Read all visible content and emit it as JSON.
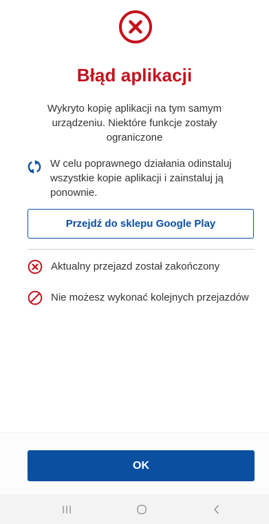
{
  "dialog": {
    "title": "Błąd aplikacji",
    "description": "Wykryto kopię aplikacji na tym samym urządzeniu. Niektóre funkcje zostały ograniczone",
    "reinstall_info": "W celu poprawnego działania odinstaluj wszystkie kopie aplikacji i zainstaluj ją ponownie.",
    "store_button_label": "Przejdź do sklepu Google Play",
    "status_items": [
      {
        "icon": "x-circle-icon",
        "text": "Aktualny przejazd został zakończony"
      },
      {
        "icon": "prohibited-icon",
        "text": "Nie możesz wykonać kolejnych przejazdów"
      }
    ],
    "ok_button_label": "OK"
  },
  "icons": {
    "header": "error-circle-icon",
    "reinstall": "sync-arrows-icon",
    "nav": [
      "recent-apps-icon",
      "home-icon",
      "back-icon"
    ]
  },
  "colors": {
    "error_red": "#c4111d",
    "primary_blue": "#0b4fa0",
    "text": "#333333"
  }
}
